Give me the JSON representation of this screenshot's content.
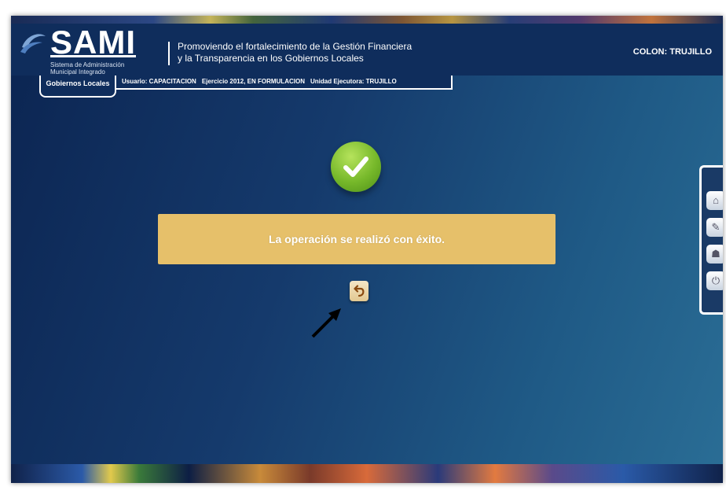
{
  "header": {
    "logo_text": "SAMI",
    "logo_sub_1": "Sistema de Administración",
    "logo_sub_2": "Municipal Integrado",
    "tagline_1": "Promoviendo el fortalecimiento de la Gestión Financiera",
    "tagline_2": "y la Transparencia en los Gobiernos Locales",
    "municipality": "COLON: TRUJILLO"
  },
  "tabs": {
    "active": "Gobiernos Locales"
  },
  "info": {
    "user": "Usuario: CAPACITACION",
    "year": "Ejercicio 2012, EN FORMULACION",
    "unit": "Unidad Ejecutora: TRUJILLO"
  },
  "main": {
    "success_icon": "check-icon",
    "message": "La operación se realizó con éxito.",
    "back_icon": "undo-arrow-icon"
  },
  "side_panel": {
    "icons": [
      "home-icon",
      "user-edit-icon",
      "ribbon-icon",
      "power-icon"
    ]
  },
  "colors": {
    "header_bg": "#0f2d5c",
    "message_bg": "#e6c06a",
    "success_green": "#76b82a"
  }
}
